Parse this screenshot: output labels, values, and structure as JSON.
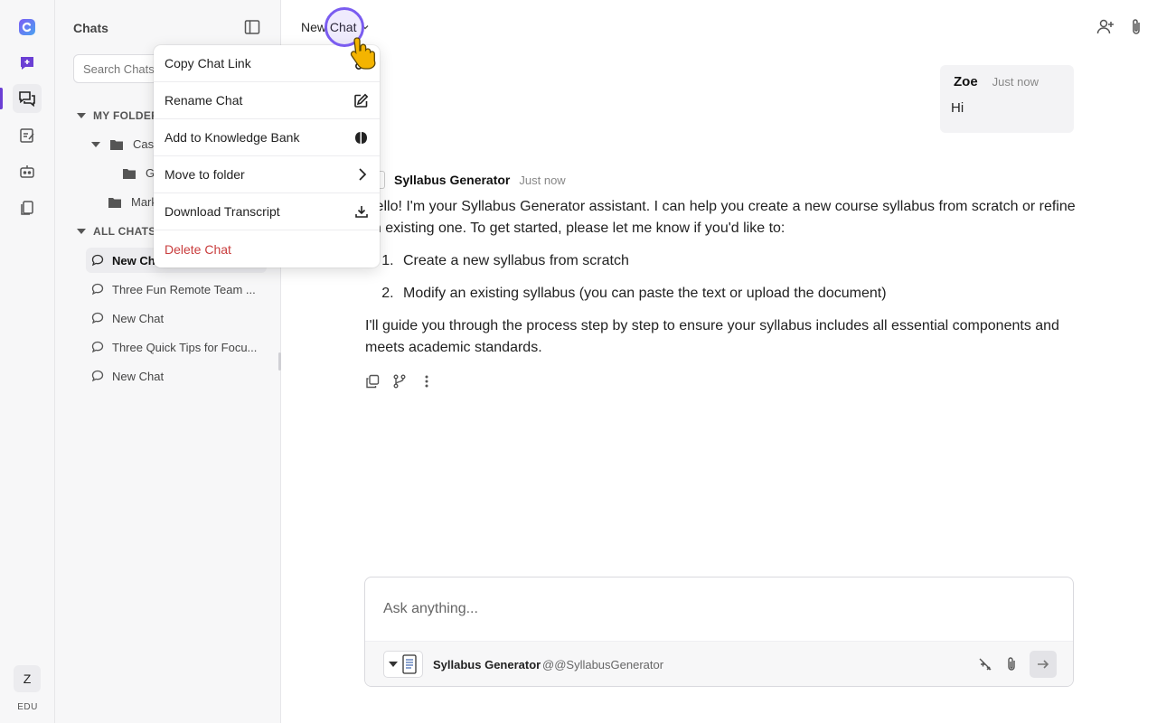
{
  "colors": {
    "accent": "#6b3fd4",
    "danger": "#c93d3d",
    "cursor": "#7a5cf0"
  },
  "rail": {
    "items": [
      "logo-icon",
      "new-chat-icon",
      "chats-icon",
      "notes-icon",
      "bot-icon",
      "documents-icon"
    ],
    "avatar_letter": "Z",
    "plan_label": "EDU"
  },
  "sidebar": {
    "title": "Chats",
    "search_placeholder": "Search Chats",
    "sections": {
      "my_folders": "MY FOLDERS",
      "all_chats": "ALL CHATS"
    },
    "folders": [
      {
        "label": "Case",
        "depth": 1,
        "expanded": true
      },
      {
        "label": "G",
        "depth": 2,
        "expanded": false
      },
      {
        "label": "Mark",
        "depth": 1,
        "expanded": false
      }
    ],
    "chats": [
      {
        "label": "New Chat",
        "active": true
      },
      {
        "label": "Three Fun Remote Team ...",
        "active": false
      },
      {
        "label": "New Chat",
        "active": false
      },
      {
        "label": "Three Quick Tips for Focu...",
        "active": false
      },
      {
        "label": "New Chat",
        "active": false
      }
    ]
  },
  "header": {
    "title": "New Chat"
  },
  "context_menu": {
    "items": [
      {
        "label": "Copy Chat Link",
        "icon": "link-icon"
      },
      {
        "label": "Rename Chat",
        "icon": "edit-icon"
      },
      {
        "label": "Add to Knowledge Bank",
        "icon": "brain-icon"
      },
      {
        "label": "Move to folder",
        "icon": "chevron-right-icon"
      },
      {
        "label": "Download Transcript",
        "icon": "download-icon"
      },
      {
        "label": "Delete Chat",
        "icon": ""
      }
    ]
  },
  "messages": {
    "user": {
      "name": "Zoe",
      "time": "Just now",
      "text": "Hi"
    },
    "bot": {
      "name": "Syllabus Generator",
      "time": "Just now",
      "intro": "Hello! I'm your Syllabus Generator assistant. I can help you create a new course syllabus from scratch or refine an existing one. To get started, please let me know if you'd like to:",
      "options": [
        "Create a new syllabus from scratch",
        "Modify an existing syllabus (you can paste the text or upload the document)"
      ],
      "outro": "I'll guide you through the process step by step to ensure your syllabus includes all essential components and meets academic standards."
    }
  },
  "composer": {
    "placeholder": "Ask anything...",
    "agent_name": "Syllabus Generator",
    "agent_handle": "@@SyllabusGenerator"
  }
}
